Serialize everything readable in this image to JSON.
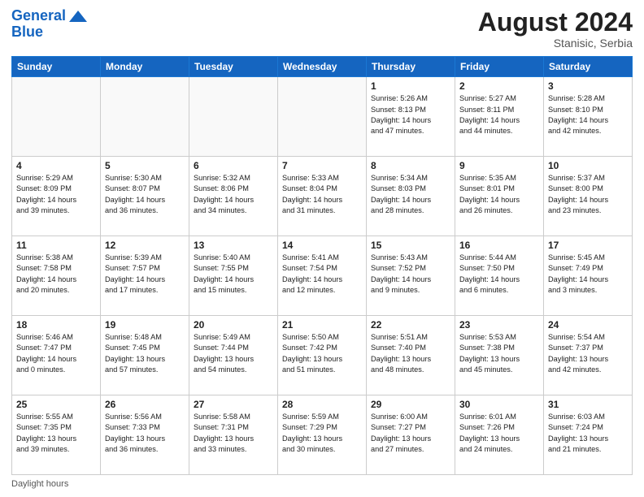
{
  "header": {
    "logo_line1": "General",
    "logo_line2": "Blue",
    "month_year": "August 2024",
    "location": "Stanisic, Serbia"
  },
  "footer": {
    "label": "Daylight hours"
  },
  "days_of_week": [
    "Sunday",
    "Monday",
    "Tuesday",
    "Wednesday",
    "Thursday",
    "Friday",
    "Saturday"
  ],
  "weeks": [
    [
      {
        "num": "",
        "info": ""
      },
      {
        "num": "",
        "info": ""
      },
      {
        "num": "",
        "info": ""
      },
      {
        "num": "",
        "info": ""
      },
      {
        "num": "1",
        "info": "Sunrise: 5:26 AM\nSunset: 8:13 PM\nDaylight: 14 hours\nand 47 minutes."
      },
      {
        "num": "2",
        "info": "Sunrise: 5:27 AM\nSunset: 8:11 PM\nDaylight: 14 hours\nand 44 minutes."
      },
      {
        "num": "3",
        "info": "Sunrise: 5:28 AM\nSunset: 8:10 PM\nDaylight: 14 hours\nand 42 minutes."
      }
    ],
    [
      {
        "num": "4",
        "info": "Sunrise: 5:29 AM\nSunset: 8:09 PM\nDaylight: 14 hours\nand 39 minutes."
      },
      {
        "num": "5",
        "info": "Sunrise: 5:30 AM\nSunset: 8:07 PM\nDaylight: 14 hours\nand 36 minutes."
      },
      {
        "num": "6",
        "info": "Sunrise: 5:32 AM\nSunset: 8:06 PM\nDaylight: 14 hours\nand 34 minutes."
      },
      {
        "num": "7",
        "info": "Sunrise: 5:33 AM\nSunset: 8:04 PM\nDaylight: 14 hours\nand 31 minutes."
      },
      {
        "num": "8",
        "info": "Sunrise: 5:34 AM\nSunset: 8:03 PM\nDaylight: 14 hours\nand 28 minutes."
      },
      {
        "num": "9",
        "info": "Sunrise: 5:35 AM\nSunset: 8:01 PM\nDaylight: 14 hours\nand 26 minutes."
      },
      {
        "num": "10",
        "info": "Sunrise: 5:37 AM\nSunset: 8:00 PM\nDaylight: 14 hours\nand 23 minutes."
      }
    ],
    [
      {
        "num": "11",
        "info": "Sunrise: 5:38 AM\nSunset: 7:58 PM\nDaylight: 14 hours\nand 20 minutes."
      },
      {
        "num": "12",
        "info": "Sunrise: 5:39 AM\nSunset: 7:57 PM\nDaylight: 14 hours\nand 17 minutes."
      },
      {
        "num": "13",
        "info": "Sunrise: 5:40 AM\nSunset: 7:55 PM\nDaylight: 14 hours\nand 15 minutes."
      },
      {
        "num": "14",
        "info": "Sunrise: 5:41 AM\nSunset: 7:54 PM\nDaylight: 14 hours\nand 12 minutes."
      },
      {
        "num": "15",
        "info": "Sunrise: 5:43 AM\nSunset: 7:52 PM\nDaylight: 14 hours\nand 9 minutes."
      },
      {
        "num": "16",
        "info": "Sunrise: 5:44 AM\nSunset: 7:50 PM\nDaylight: 14 hours\nand 6 minutes."
      },
      {
        "num": "17",
        "info": "Sunrise: 5:45 AM\nSunset: 7:49 PM\nDaylight: 14 hours\nand 3 minutes."
      }
    ],
    [
      {
        "num": "18",
        "info": "Sunrise: 5:46 AM\nSunset: 7:47 PM\nDaylight: 14 hours\nand 0 minutes."
      },
      {
        "num": "19",
        "info": "Sunrise: 5:48 AM\nSunset: 7:45 PM\nDaylight: 13 hours\nand 57 minutes."
      },
      {
        "num": "20",
        "info": "Sunrise: 5:49 AM\nSunset: 7:44 PM\nDaylight: 13 hours\nand 54 minutes."
      },
      {
        "num": "21",
        "info": "Sunrise: 5:50 AM\nSunset: 7:42 PM\nDaylight: 13 hours\nand 51 minutes."
      },
      {
        "num": "22",
        "info": "Sunrise: 5:51 AM\nSunset: 7:40 PM\nDaylight: 13 hours\nand 48 minutes."
      },
      {
        "num": "23",
        "info": "Sunrise: 5:53 AM\nSunset: 7:38 PM\nDaylight: 13 hours\nand 45 minutes."
      },
      {
        "num": "24",
        "info": "Sunrise: 5:54 AM\nSunset: 7:37 PM\nDaylight: 13 hours\nand 42 minutes."
      }
    ],
    [
      {
        "num": "25",
        "info": "Sunrise: 5:55 AM\nSunset: 7:35 PM\nDaylight: 13 hours\nand 39 minutes."
      },
      {
        "num": "26",
        "info": "Sunrise: 5:56 AM\nSunset: 7:33 PM\nDaylight: 13 hours\nand 36 minutes."
      },
      {
        "num": "27",
        "info": "Sunrise: 5:58 AM\nSunset: 7:31 PM\nDaylight: 13 hours\nand 33 minutes."
      },
      {
        "num": "28",
        "info": "Sunrise: 5:59 AM\nSunset: 7:29 PM\nDaylight: 13 hours\nand 30 minutes."
      },
      {
        "num": "29",
        "info": "Sunrise: 6:00 AM\nSunset: 7:27 PM\nDaylight: 13 hours\nand 27 minutes."
      },
      {
        "num": "30",
        "info": "Sunrise: 6:01 AM\nSunset: 7:26 PM\nDaylight: 13 hours\nand 24 minutes."
      },
      {
        "num": "31",
        "info": "Sunrise: 6:03 AM\nSunset: 7:24 PM\nDaylight: 13 hours\nand 21 minutes."
      }
    ]
  ]
}
